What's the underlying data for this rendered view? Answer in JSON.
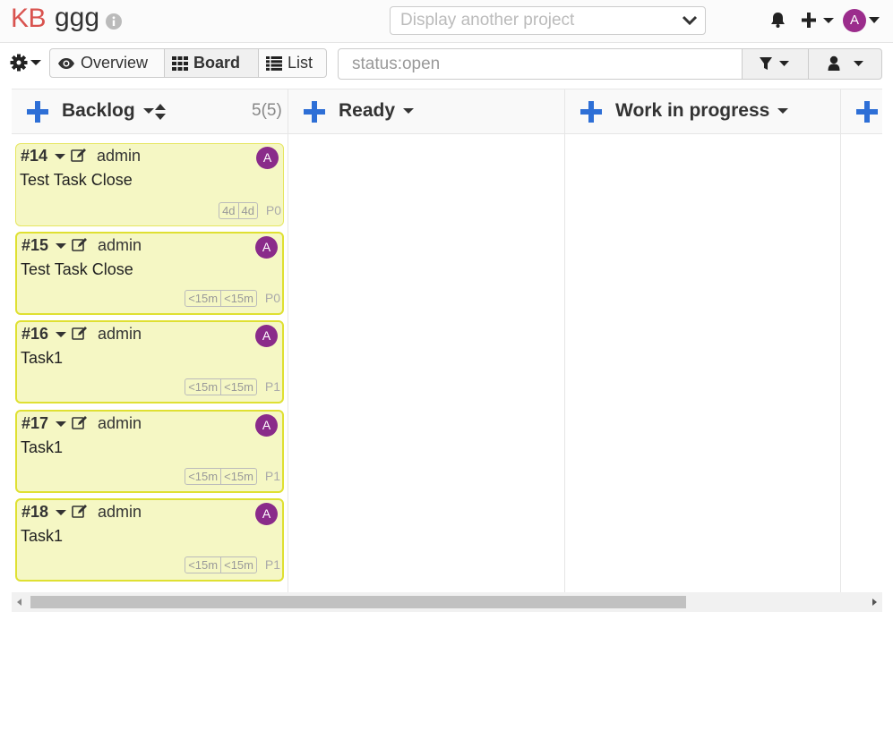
{
  "header": {
    "logo": "KB",
    "project_name": "ggg",
    "project_select_placeholder": "Display another project",
    "avatar_letter": "A"
  },
  "toolbar": {
    "views": [
      {
        "label": "Overview",
        "icon": "eye-icon"
      },
      {
        "label": "Board",
        "icon": "grid-icon",
        "active": true
      },
      {
        "label": "List",
        "icon": "list-icon"
      }
    ],
    "search_value": "status:open"
  },
  "columns": [
    {
      "title": "Backlog",
      "count": "5(5)"
    },
    {
      "title": "Ready",
      "count": ""
    },
    {
      "title": "Work in progress",
      "count": ""
    }
  ],
  "tasks": [
    {
      "id": "#14",
      "owner": "admin",
      "avatar": "A",
      "title": "Test Task Close",
      "time_spent": "4d",
      "time_estimated": "4d",
      "priority": "P0"
    },
    {
      "id": "#15",
      "owner": "admin",
      "avatar": "A",
      "title": "Test Task Close",
      "time_spent": "<15m",
      "time_estimated": "<15m",
      "priority": "P0"
    },
    {
      "id": "#16",
      "owner": "admin",
      "avatar": "A",
      "title": "Task1",
      "time_spent": "<15m",
      "time_estimated": "<15m",
      "priority": "P1"
    },
    {
      "id": "#17",
      "owner": "admin",
      "avatar": "A",
      "title": "Task1",
      "time_spent": "<15m",
      "time_estimated": "<15m",
      "priority": "P1"
    },
    {
      "id": "#18",
      "owner": "admin",
      "avatar": "A",
      "title": "Task1",
      "time_spent": "<15m",
      "time_estimated": "<15m",
      "priority": "P1"
    }
  ],
  "colors": {
    "accent_blue": "#2e6fd6",
    "logo_red": "#d9534f",
    "avatar_purple": "#8a2b8a",
    "card_bg": "#f5f7c4",
    "card_border": "#dfe032"
  }
}
